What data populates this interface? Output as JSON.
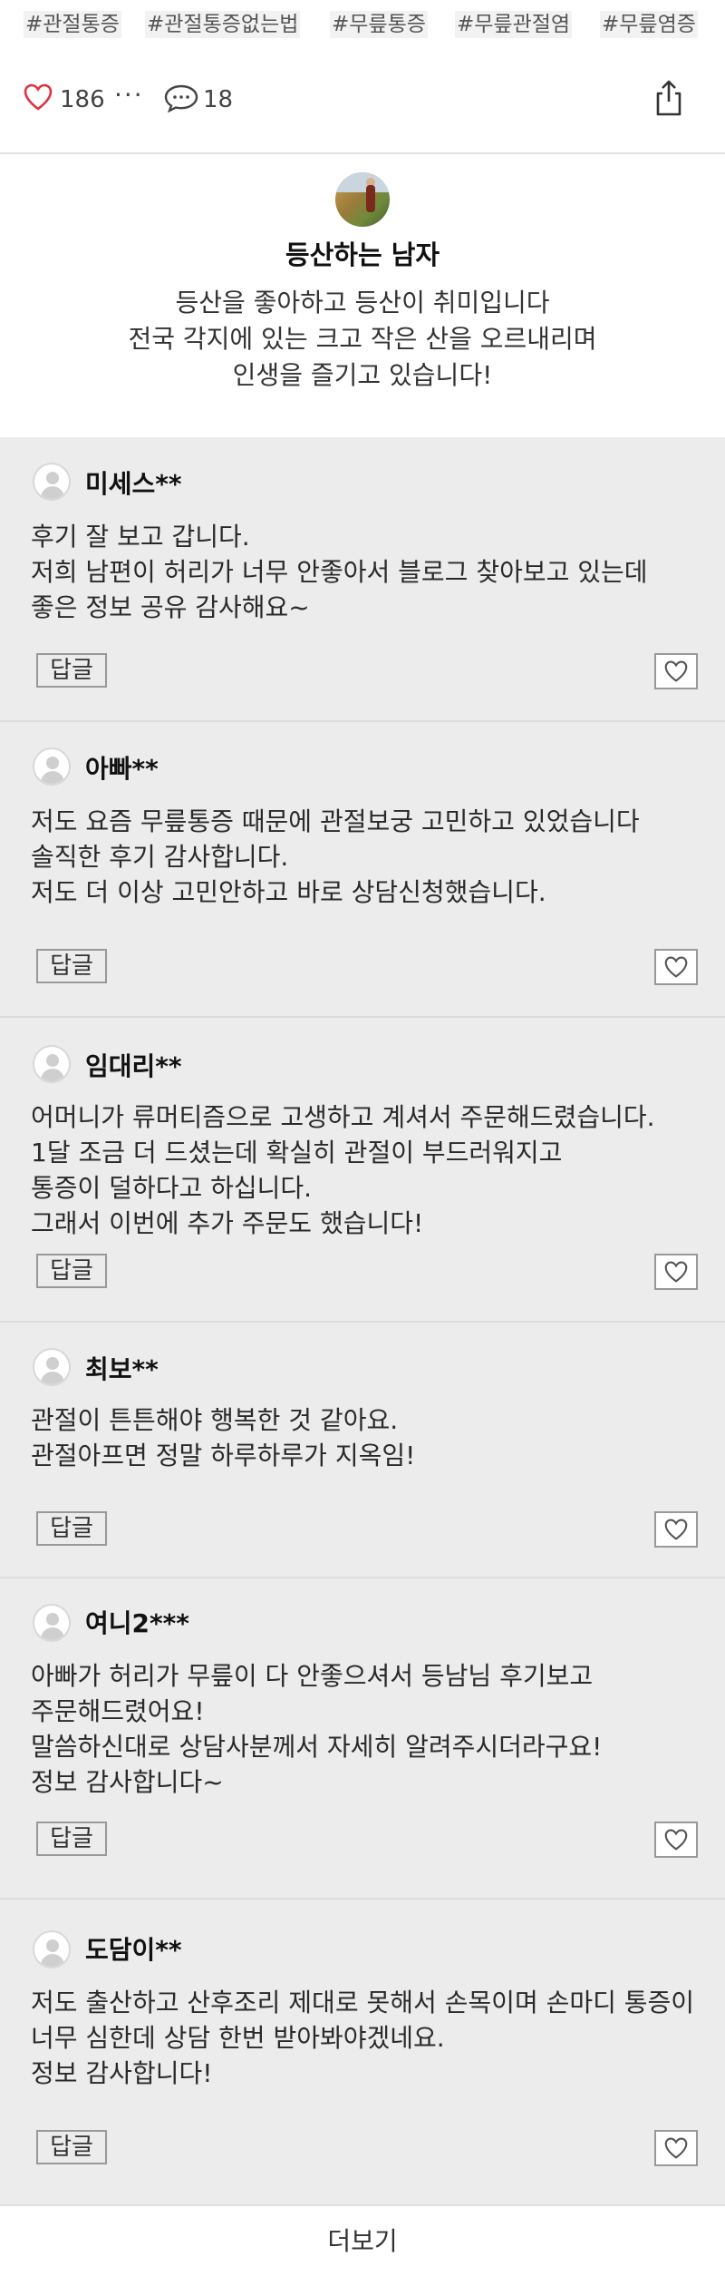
{
  "tags": [
    "#관절통증",
    "#관절통증없는법",
    "#무릎통증",
    "#무릎관절염",
    "#무릎염증"
  ],
  "actions": {
    "like_count": "186",
    "more": "···",
    "comment_count": "18"
  },
  "profile": {
    "name": "등산하는 남자",
    "description": "등산을 좋아하고 등산이 취미입니다\n전국 각지에 있는 크고 작은 산을 오르내리며\n인생을 즐기고 있습니다!"
  },
  "comments": [
    {
      "author": "미세스**",
      "text": "후기 잘 보고 갑니다.\n저희 남편이 허리가 너무 안좋아서 블로그 찾아보고 있는데\n좋은 정보 공유 감사해요~",
      "reply_label": "답글"
    },
    {
      "author": "아빠**",
      "text": "저도 요즘 무릎통증 때문에 관절보궁 고민하고 있었습니다\n솔직한 후기 감사합니다.\n저도 더 이상 고민안하고 바로 상담신청했습니다.",
      "reply_label": "답글"
    },
    {
      "author": "임대리**",
      "text": "어머니가 류머티즘으로 고생하고 계셔서 주문해드렸습니다.\n1달 조금 더 드셨는데 확실히 관절이 부드러워지고\n통증이 덜하다고 하십니다.\n그래서 이번에 추가 주문도 했습니다!",
      "reply_label": "답글"
    },
    {
      "author": "최보**",
      "text": "관절이 튼튼해야 행복한 것 같아요.\n관절아프면 정말 하루하루가 지옥임!",
      "reply_label": "답글"
    },
    {
      "author": "여니2***",
      "text": "아빠가 허리가 무릎이 다 안좋으셔서 등남님 후기보고\n주문해드렸어요!\n말씀하신대로 상담사분께서 자세히 알려주시더라구요!\n정보 감사합니다~",
      "reply_label": "답글"
    },
    {
      "author": "도담이**",
      "text": "저도 출산하고 산후조리 제대로 못해서 손목이며 손마디 통증이\n너무 심한데 상담 한번 받아봐야겠네요.\n정보 감사합니다!",
      "reply_label": "답글"
    }
  ],
  "more_label": "더보기",
  "colors": {
    "heart": "#e0313f",
    "background_comments": "#ececec"
  }
}
